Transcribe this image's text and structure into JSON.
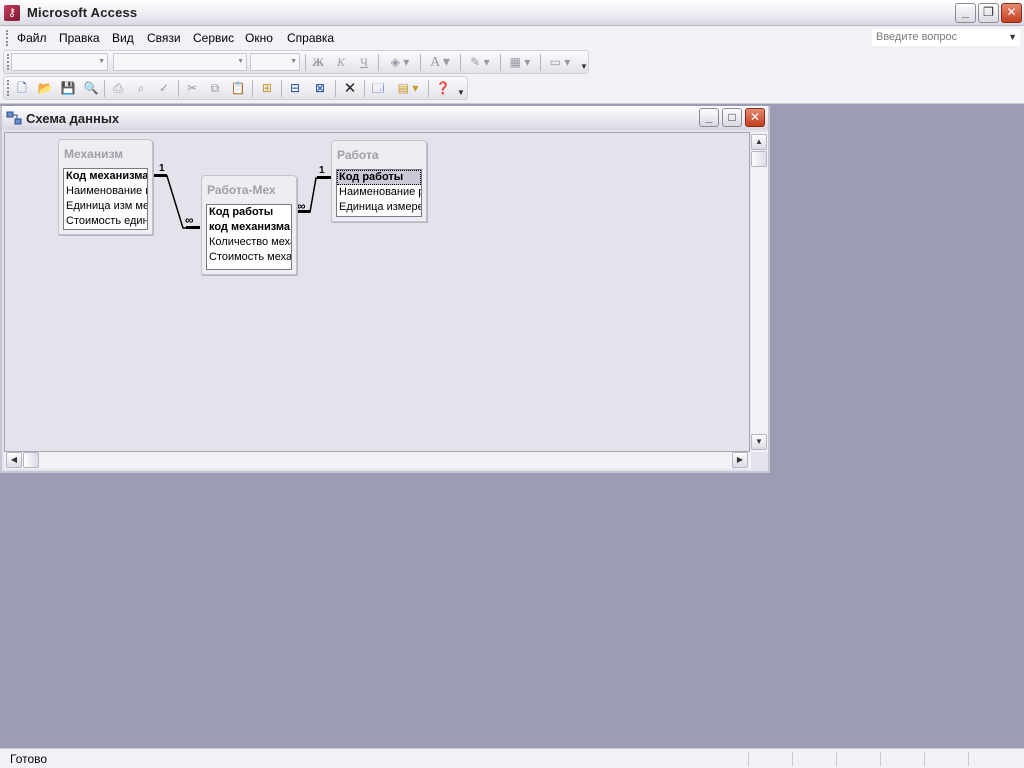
{
  "app": {
    "title": "Microsoft Access",
    "icon": "access-key-icon"
  },
  "menubar": {
    "items": [
      "Файл",
      "Правка",
      "Вид",
      "Связи",
      "Сервис",
      "Окно",
      "Справка"
    ],
    "help_placeholder": "Введите вопрос"
  },
  "format_toolbar": {
    "bold": "Ж",
    "italic": "К",
    "underline": "Ч",
    "font_color": "A"
  },
  "schema_window": {
    "title": "Схема данных",
    "tables": [
      {
        "name": "Механизм",
        "fields": [
          {
            "label": "Код механизма",
            "primary_key": true,
            "selected": false
          },
          {
            "label": "Наименование м",
            "primary_key": false,
            "selected": false
          },
          {
            "label": "Единица изм мех",
            "primary_key": false,
            "selected": false
          },
          {
            "label": "Стоимость един",
            "primary_key": false,
            "selected": false
          }
        ]
      },
      {
        "name": "Работа-Мех",
        "fields": [
          {
            "label": "Код работы",
            "primary_key": true,
            "selected": false
          },
          {
            "label": "код механизма",
            "primary_key": true,
            "selected": false
          },
          {
            "label": "Количество меха",
            "primary_key": false,
            "selected": false
          },
          {
            "label": "Стоимость механ",
            "primary_key": false,
            "selected": false
          }
        ]
      },
      {
        "name": "Работа",
        "fields": [
          {
            "label": "Код работы",
            "primary_key": true,
            "selected": true
          },
          {
            "label": "Наименование р",
            "primary_key": false,
            "selected": false
          },
          {
            "label": "Единица измерен",
            "primary_key": false,
            "selected": false
          }
        ]
      }
    ],
    "relationships": [
      {
        "from": "Механизм.Код механизма",
        "to": "Работа-Мех.код механизма",
        "one": "1",
        "many": "∞"
      },
      {
        "from": "Работа.Код работы",
        "to": "Работа-Мех.Код работы",
        "one": "1",
        "many": "∞"
      }
    ]
  },
  "statusbar": {
    "text": "Готово"
  },
  "colors": {
    "workspace": "#9c9cb4",
    "chrome": "#f2f1f6",
    "close_button": "#c4401e"
  }
}
